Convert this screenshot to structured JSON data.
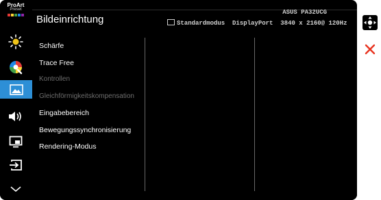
{
  "logo": {
    "line1": "ProArt",
    "line2": "Preset"
  },
  "header": {
    "title": "Bildeinrichtung",
    "mode": "Standardmodus",
    "input": "DisplayPort",
    "resolution": "3840 x 2160@ 120Hz",
    "model": "ASUS PA32UCG"
  },
  "sidebar": {
    "items": [
      {
        "name": "blue-light-icon"
      },
      {
        "name": "color-icon"
      },
      {
        "name": "image-icon",
        "active": true
      },
      {
        "name": "sound-icon"
      },
      {
        "name": "pip-icon"
      },
      {
        "name": "input-select-icon"
      },
      {
        "name": "chevron-down-icon"
      }
    ]
  },
  "menu": {
    "items": [
      {
        "label": "Schärfe"
      },
      {
        "label": "Trace Free"
      },
      {
        "label": "Kontrollen",
        "disabled": true
      },
      {
        "label": "Gleichförmigkeitskompensation",
        "disabled": true
      },
      {
        "label": "Eingabebereich"
      },
      {
        "label": "Bewegungssynchronisierung"
      },
      {
        "label": "Rendering-Modus"
      }
    ]
  },
  "controls": {
    "navigate": "dpad-icon",
    "close": "close-icon"
  },
  "colors": {
    "accent": "#2d8fd6",
    "close": "#e8321e",
    "background": "#000000"
  }
}
